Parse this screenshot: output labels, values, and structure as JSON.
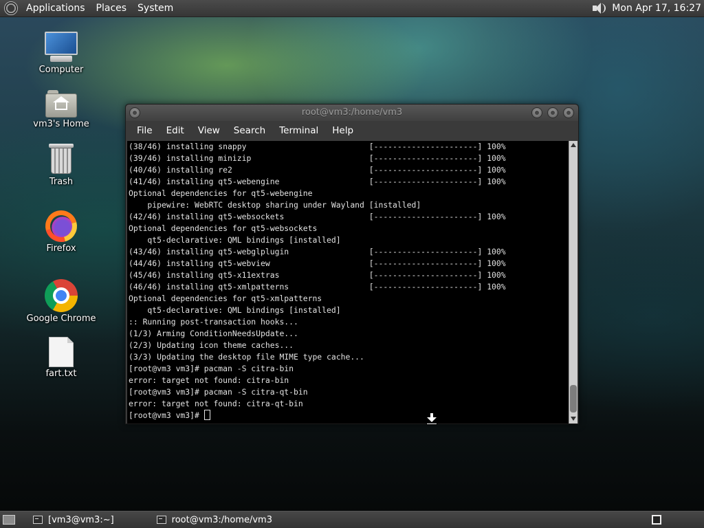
{
  "top_panel": {
    "menus": [
      "Applications",
      "Places",
      "System"
    ],
    "clock": "Mon Apr 17, 16:27"
  },
  "desktop_icons": [
    {
      "label": "Computer",
      "icon": "computer-icon"
    },
    {
      "label": "vm3's Home",
      "icon": "home-folder-icon"
    },
    {
      "label": "Trash",
      "icon": "trash-icon"
    },
    {
      "label": "Firefox",
      "icon": "firefox-icon"
    },
    {
      "label": "Google Chrome",
      "icon": "chrome-icon"
    },
    {
      "label": "fart.txt",
      "icon": "text-file-icon"
    }
  ],
  "terminal": {
    "title": "root@vm3:/home/vm3",
    "menu": [
      "File",
      "Edit",
      "View",
      "Search",
      "Terminal",
      "Help"
    ],
    "lines": [
      "(38/46) installing snappy                          [----------------------] 100%",
      "(39/46) installing minizip                         [----------------------] 100%",
      "(40/46) installing re2                             [----------------------] 100%",
      "(41/46) installing qt5-webengine                   [----------------------] 100%",
      "Optional dependencies for qt5-webengine",
      "    pipewire: WebRTC desktop sharing under Wayland [installed]",
      "(42/46) installing qt5-websockets                  [----------------------] 100%",
      "Optional dependencies for qt5-websockets",
      "    qt5-declarative: QML bindings [installed]",
      "(43/46) installing qt5-webglplugin                 [----------------------] 100%",
      "(44/46) installing qt5-webview                     [----------------------] 100%",
      "(45/46) installing qt5-x11extras                   [----------------------] 100%",
      "(46/46) installing qt5-xmlpatterns                 [----------------------] 100%",
      "Optional dependencies for qt5-xmlpatterns",
      "    qt5-declarative: QML bindings [installed]",
      ":: Running post-transaction hooks...",
      "(1/3) Arming ConditionNeedsUpdate...",
      "(2/3) Updating icon theme caches...",
      "(3/3) Updating the desktop file MIME type cache...",
      "[root@vm3 vm3]# pacman -S citra-bin",
      "error: target not found: citra-bin",
      "[root@vm3 vm3]# pacman -S citra-qt-bin",
      "error: target not found: citra-qt-bin"
    ],
    "prompt": "[root@vm3 vm3]# "
  },
  "bottom_panel": {
    "tasks": [
      "[vm3@vm3:~]",
      "root@vm3:/home/vm3"
    ]
  }
}
